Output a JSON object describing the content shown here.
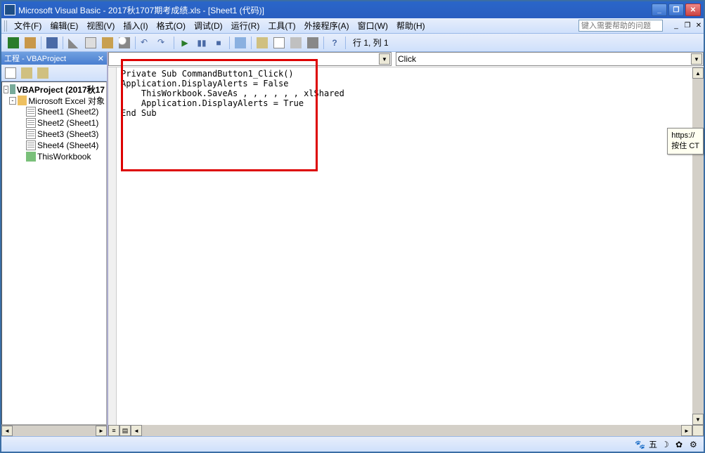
{
  "window": {
    "title": "Microsoft Visual Basic - 2017秋1707期考成绩.xls - [Sheet1 (代码)]"
  },
  "menu": {
    "file": "文件(F)",
    "edit": "编辑(E)",
    "view": "视图(V)",
    "insert": "插入(I)",
    "format": "格式(O)",
    "debug": "调试(D)",
    "run": "运行(R)",
    "tools": "工具(T)",
    "addins": "外接程序(A)",
    "window": "窗口(W)",
    "help": "帮助(H)",
    "help_placeholder": "键入需要帮助的问题"
  },
  "toolbar": {
    "status": "行 1, 列 1"
  },
  "project": {
    "title": "工程 - VBAProject",
    "root": "VBAProject (2017秋17",
    "excel_group": "Microsoft Excel 对象",
    "items": [
      {
        "label": "Sheet1 (Sheet2)"
      },
      {
        "label": "Sheet2 (Sheet1)"
      },
      {
        "label": "Sheet3 (Sheet3)"
      },
      {
        "label": "Sheet4 (Sheet4)"
      },
      {
        "label": "ThisWorkbook"
      }
    ]
  },
  "code": {
    "object_value": "",
    "proc_value": "Click",
    "text": "Private Sub CommandButton1_Click()\nApplication.DisplayAlerts = False\n    ThisWorkbook.SaveAs , , , , , , xlShared\n    Application.DisplayAlerts = True\nEnd Sub"
  },
  "tooltip": {
    "line1": "https://",
    "line2": "按住 CT"
  },
  "status": {
    "wubi": "五"
  }
}
